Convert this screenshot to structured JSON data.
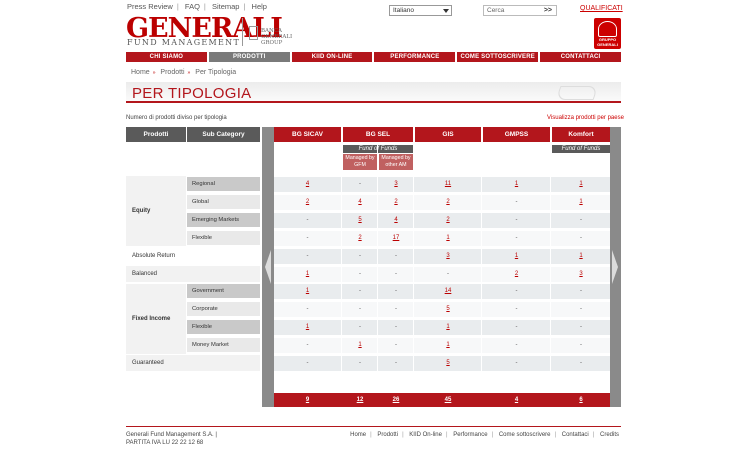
{
  "toplinks": [
    "Press Review",
    "FAQ",
    "Sitemap",
    "Help"
  ],
  "language": "Italiano",
  "search": {
    "placeholder": "Cerca",
    "go": ">>"
  },
  "qualified": "QUALIFICATI",
  "logo": {
    "name": "GENERALI",
    "sub": "FUND MANAGEMENT",
    "banca": "BANCA GENERALI GROUP",
    "seal": "GRUPPO GENERALI"
  },
  "nav": [
    "CHI SIAMO",
    "PRODOTTI",
    "KIID ON-LINE",
    "PERFORMANCE",
    "COME SOTTOSCRIVERE",
    "CONTATTACI"
  ],
  "breadcrumb": [
    "Home",
    "Prodotti",
    "Per Tipologia"
  ],
  "page_title": "PER TIPOLOGIA",
  "subtitle": "Numero di prodotti diviso per tipologia",
  "country_link": "Visualizza prodotti per paese",
  "table": {
    "hdr_left": [
      "Prodotti",
      "Sub Category"
    ],
    "cols": [
      "BG SICAV",
      "BG SEL",
      "GIS",
      "GMPSS",
      "Komfort"
    ],
    "fof": "Fund of Funds",
    "managed": [
      "Managed by GFM",
      "Managed by other AM"
    ],
    "cats": [
      "Equity",
      "Absolute Return",
      "Balanced",
      "Fixed Income",
      "Guaranteed"
    ],
    "subs": [
      "Regional",
      "Global",
      "Emerging Markets",
      "Flexible",
      "Government",
      "Corporate",
      "Flexible",
      "Money Market"
    ],
    "rows": [
      [
        "4",
        "-",
        "3",
        "11",
        "1",
        "1"
      ],
      [
        "2",
        "4",
        "2",
        "2",
        "-",
        "1"
      ],
      [
        "-",
        "5",
        "4",
        "2",
        "-",
        "-"
      ],
      [
        "-",
        "2",
        "17",
        "1",
        "-",
        "-"
      ],
      [
        "-",
        "-",
        "-",
        "3",
        "1",
        "1"
      ],
      [
        "1",
        "-",
        "-",
        "-",
        "2",
        "3"
      ],
      [
        "1",
        "-",
        "-",
        "14",
        "-",
        "-"
      ],
      [
        "-",
        "-",
        "-",
        "5",
        "-",
        "-"
      ],
      [
        "1",
        "-",
        "-",
        "1",
        "-",
        "-"
      ],
      [
        "-",
        "1",
        "-",
        "1",
        "-",
        "-"
      ],
      [
        "-",
        "-",
        "-",
        "5",
        "-",
        "-"
      ]
    ],
    "totals": [
      "9",
      "12",
      "26",
      "45",
      "4",
      "6"
    ]
  },
  "footer": {
    "company": "Generali Fund Management S.A. |",
    "vat": "PARTITA IVA LU 22 22 12 68",
    "links": [
      "Home",
      "Prodotti",
      "KIID On-line",
      "Performance",
      "Come sottoscrivere",
      "Contattaci",
      "Credits"
    ]
  },
  "colors": {
    "accent": "#b3161c",
    "header_gray": "#5a5a5a"
  }
}
